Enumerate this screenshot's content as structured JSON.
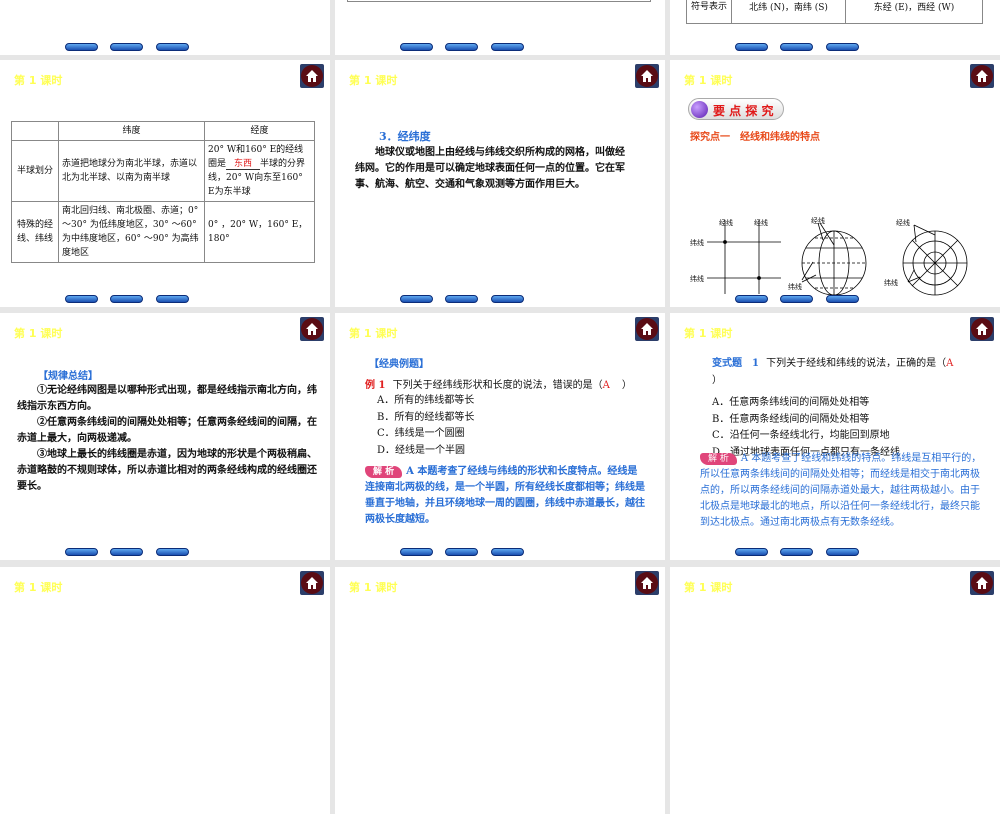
{
  "lesson_title": "第 1 课时",
  "slide_top_right": {
    "row_label": "符号表示",
    "lat": "北纬 (N)，南纬 (S)",
    "lon": "东经 (E)，西经 (W)"
  },
  "table_slide": {
    "headers": [
      "",
      "纬度",
      "经度"
    ],
    "rows": [
      {
        "label": "半球划分",
        "lat": "赤道把地球分为南北半球，赤道以北为北半球、以南为南半球",
        "lon_pre": "20° W和160° E的经线圈是",
        "lon_blank": "东西",
        "lon_post": "半球的分界线，20° W向东至160° E为东半球"
      },
      {
        "label": "特殊的经线、纬线",
        "lat": "南北回归线、南北极圈、赤道；0° ～30° 为低纬度地区，30° ～60° 为中纬度地区，60° ～90° 为高纬度地区",
        "lon": "0° ，20° W，160° E，180°"
      }
    ]
  },
  "grid_slide": {
    "heading": "3．经纬度",
    "body": "地球仪或地图上由经线与纬线交织所构成的网格，叫做经纬网。它的作用是可以确定地球表面任何一点的位置。它在军事、航海、航空、交通和气象观测等方面作用巨大。"
  },
  "explore_slide": {
    "badge": "要 点 探 究",
    "subtitle": "探究点一　经线和纬线的特点",
    "labels": {
      "jing": "经线",
      "wei": "纬线"
    }
  },
  "rules_slide": {
    "heading": "【规律总结】",
    "items": [
      "①无论经纬网图是以哪种形式出现，都是经线指示南北方向，纬线指示东西方向。",
      "②任意两条纬线间的间隔处处相等；任意两条经线间的间隔，在赤道上最大，向两极递减。",
      "③地球上最长的纬线圈是赤道，因为地球的形状是个两极稍扁、赤道略鼓的不规则球体，所以赤道比相对的两条经线构成的经线圈还要长。"
    ]
  },
  "example_slide": {
    "heading": "【经典例题】",
    "label": "例 1",
    "question": "下列关于经纬线形状和长度的说法，错误的是（",
    "answer": "A",
    "close": "）",
    "options": [
      "A．所有的纬线都等长",
      "B．所有的经线都等长",
      "C．纬线是一个圆圈",
      "D．经线是一个半圆"
    ],
    "analysis_tag": "解 析",
    "analysis": "A 本题考查了经线与纬线的形状和长度特点。经线是连接南北两极的线，是一个半圆，所有经线长度都相等；纬线是垂直于地轴，并且环绕地球一周的圆圈，纬线中赤道最长，越往两极长度越短。"
  },
  "variant_slide": {
    "label": "变式题　1",
    "question": "下列关于经线和纬线的说法，正确的是（",
    "answer": "A",
    "close": "）",
    "options": [
      "A．任意两条纬线间的间隔处处相等",
      "B．任意两条经线间的间隔处处相等",
      "C．沿任何一条经线北行，均能回到原地",
      "D．通过地球表面任何一点都只有一条经线"
    ],
    "analysis_tag": "解 析",
    "analysis": "A 本题考查了经线和纬线的特点。纬线是互相平行的，所以任意两条纬线间的间隔处处相等；而经线是相交于南北两极点的，所以两条经线间的间隔赤道处最大，越往两极越小。由于北极点是地球最北的地点，所以沿任何一条经线北行，最终只能到达北极点。通过南北两极点有无数条经线。"
  }
}
